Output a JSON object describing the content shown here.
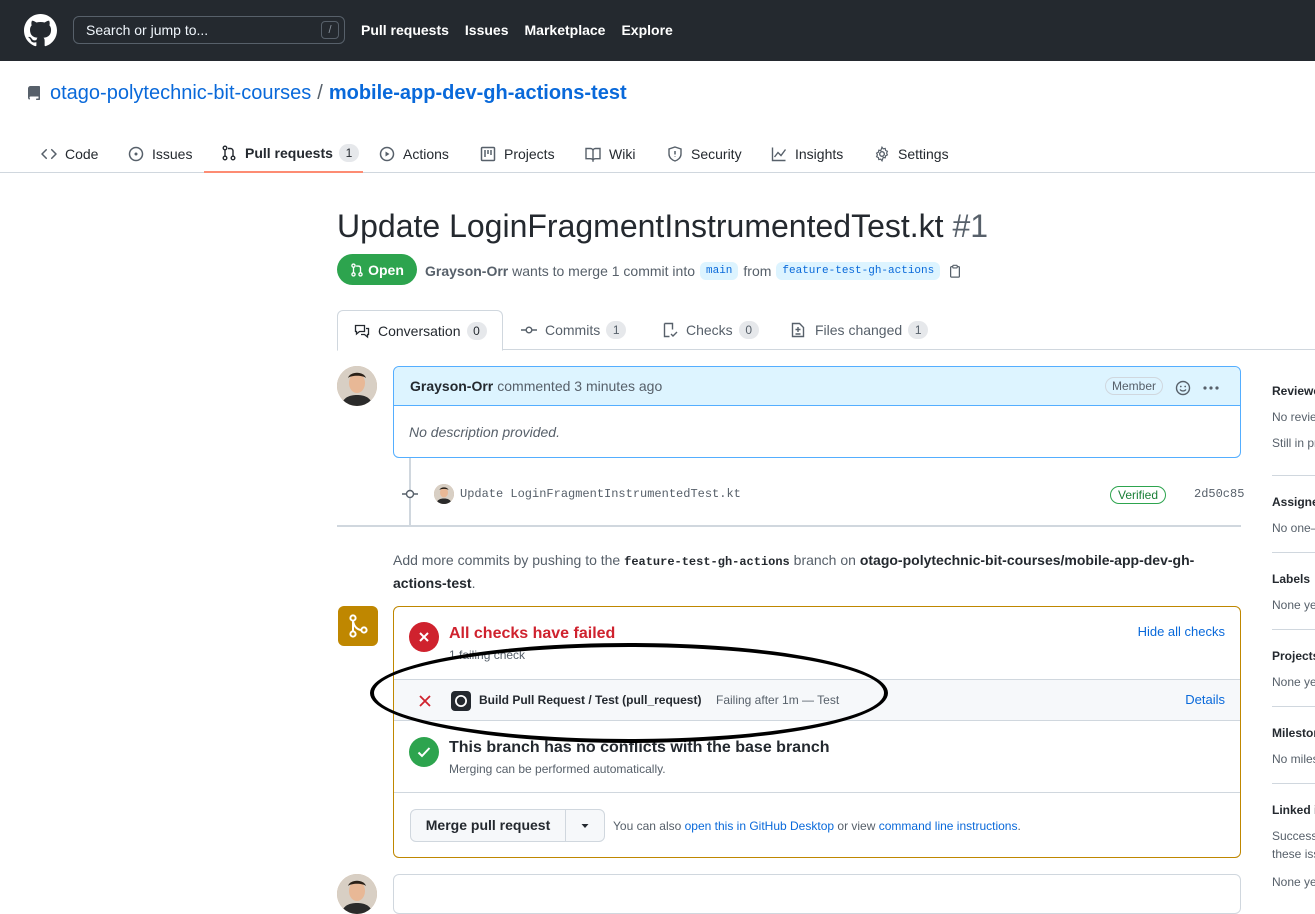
{
  "header": {
    "search_placeholder": "Search or jump to...",
    "search_key": "/",
    "nav": [
      "Pull requests",
      "Issues",
      "Marketplace",
      "Explore"
    ]
  },
  "repo": {
    "owner": "otago-polytechnic-bit-courses",
    "separator": "/",
    "name": "mobile-app-dev-gh-actions-test"
  },
  "repo_tabs": [
    {
      "label": "Code",
      "icon": "code-icon"
    },
    {
      "label": "Issues",
      "icon": "issue-icon"
    },
    {
      "label": "Pull requests",
      "icon": "pull-request-icon",
      "count": "1"
    },
    {
      "label": "Actions",
      "icon": "play-icon"
    },
    {
      "label": "Projects",
      "icon": "project-icon"
    },
    {
      "label": "Wiki",
      "icon": "book-icon"
    },
    {
      "label": "Security",
      "icon": "shield-icon"
    },
    {
      "label": "Insights",
      "icon": "graph-icon"
    },
    {
      "label": "Settings",
      "icon": "gear-icon"
    }
  ],
  "pr": {
    "title": "Update LoginFragmentInstrumentedTest.kt",
    "number": "#1",
    "state": "Open",
    "author": "Grayson-Orr",
    "merge_text": "wants to merge 1 commit into",
    "base": "main",
    "from_text": "from",
    "head": "feature-test-gh-actions"
  },
  "pr_tabs": [
    {
      "label": "Conversation",
      "count": "0"
    },
    {
      "label": "Commits",
      "count": "1"
    },
    {
      "label": "Checks",
      "count": "0"
    },
    {
      "label": "Files changed",
      "count": "1"
    }
  ],
  "comment": {
    "author": "Grayson-Orr",
    "action": "commented 3 minutes ago",
    "role": "Member",
    "body": "No description provided."
  },
  "commit": {
    "message": "Update LoginFragmentInstrumentedTest.kt",
    "verified": "Verified",
    "sha": "2d50c85"
  },
  "hint": {
    "prefix": "Add more commits by pushing to the",
    "branch": "feature-test-gh-actions",
    "mid": "branch on",
    "repo": "otago-polytechnic-bit-courses/mobile-app-dev-gh-actions-test",
    "suffix": "."
  },
  "checks": {
    "title": "All checks have failed",
    "subtitle": "1 failing check",
    "hide_link": "Hide all checks",
    "item_name": "Build Pull Request / Test (pull_request)",
    "item_status": "Failing after 1m — Test",
    "details": "Details",
    "conflict_title": "This branch has no conflicts with the base branch",
    "conflict_sub": "Merging can be performed automatically.",
    "merge_button": "Merge pull request",
    "also_prefix": "You can also",
    "desktop_link": "open this in GitHub Desktop",
    "or_view": "or view",
    "cli_link": "command line instructions",
    "period": "."
  },
  "sidebar": {
    "reviewers": "Reviewers",
    "reviewers_v1": "No reviews",
    "reviewers_v2": "Still in progress",
    "assignees": "Assignees",
    "assignees_v": "No one—",
    "labels": "Labels",
    "labels_v": "None yet",
    "projects": "Projects",
    "projects_v": "None yet",
    "milestone": "Milestone",
    "milestone_v": "No milestone",
    "linked": "Linked issues",
    "linked_v1": "Successfully",
    "linked_v2": "these issues",
    "linked_v3": "None yet"
  }
}
